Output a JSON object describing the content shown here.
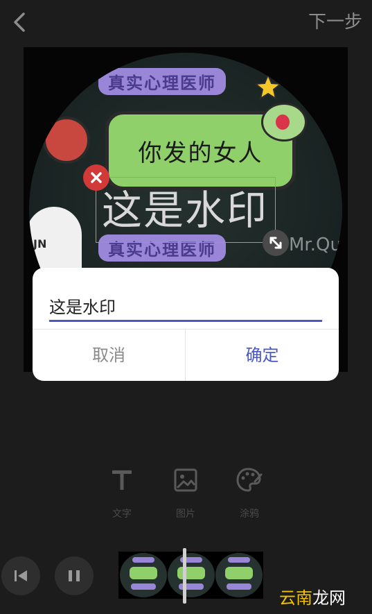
{
  "header": {
    "next_label": "下一步"
  },
  "canvas": {
    "sticker_top_pill": "真实心理医师",
    "sticker_bubble": "你发的女人",
    "sticker_bottom_pill": "真实心理医师",
    "sticker_bear_text": "JN",
    "sticker_signature": "Mr.Qu"
  },
  "watermark": {
    "text": "这是水印"
  },
  "dialog": {
    "input_value": "这是水印",
    "cancel_label": "取消",
    "confirm_label": "确定",
    "accent_color": "#4a58c4"
  },
  "tools": [
    {
      "label": "文字",
      "icon": "text-icon"
    },
    {
      "label": "图片",
      "icon": "image-icon"
    },
    {
      "label": "涂鸦",
      "icon": "palette-icon"
    }
  ],
  "logo": {
    "text_primary": "云南",
    "text_accent": "龙网"
  },
  "colors": {
    "background": "#1c1c1c",
    "delete_red": "#d23a3a"
  }
}
